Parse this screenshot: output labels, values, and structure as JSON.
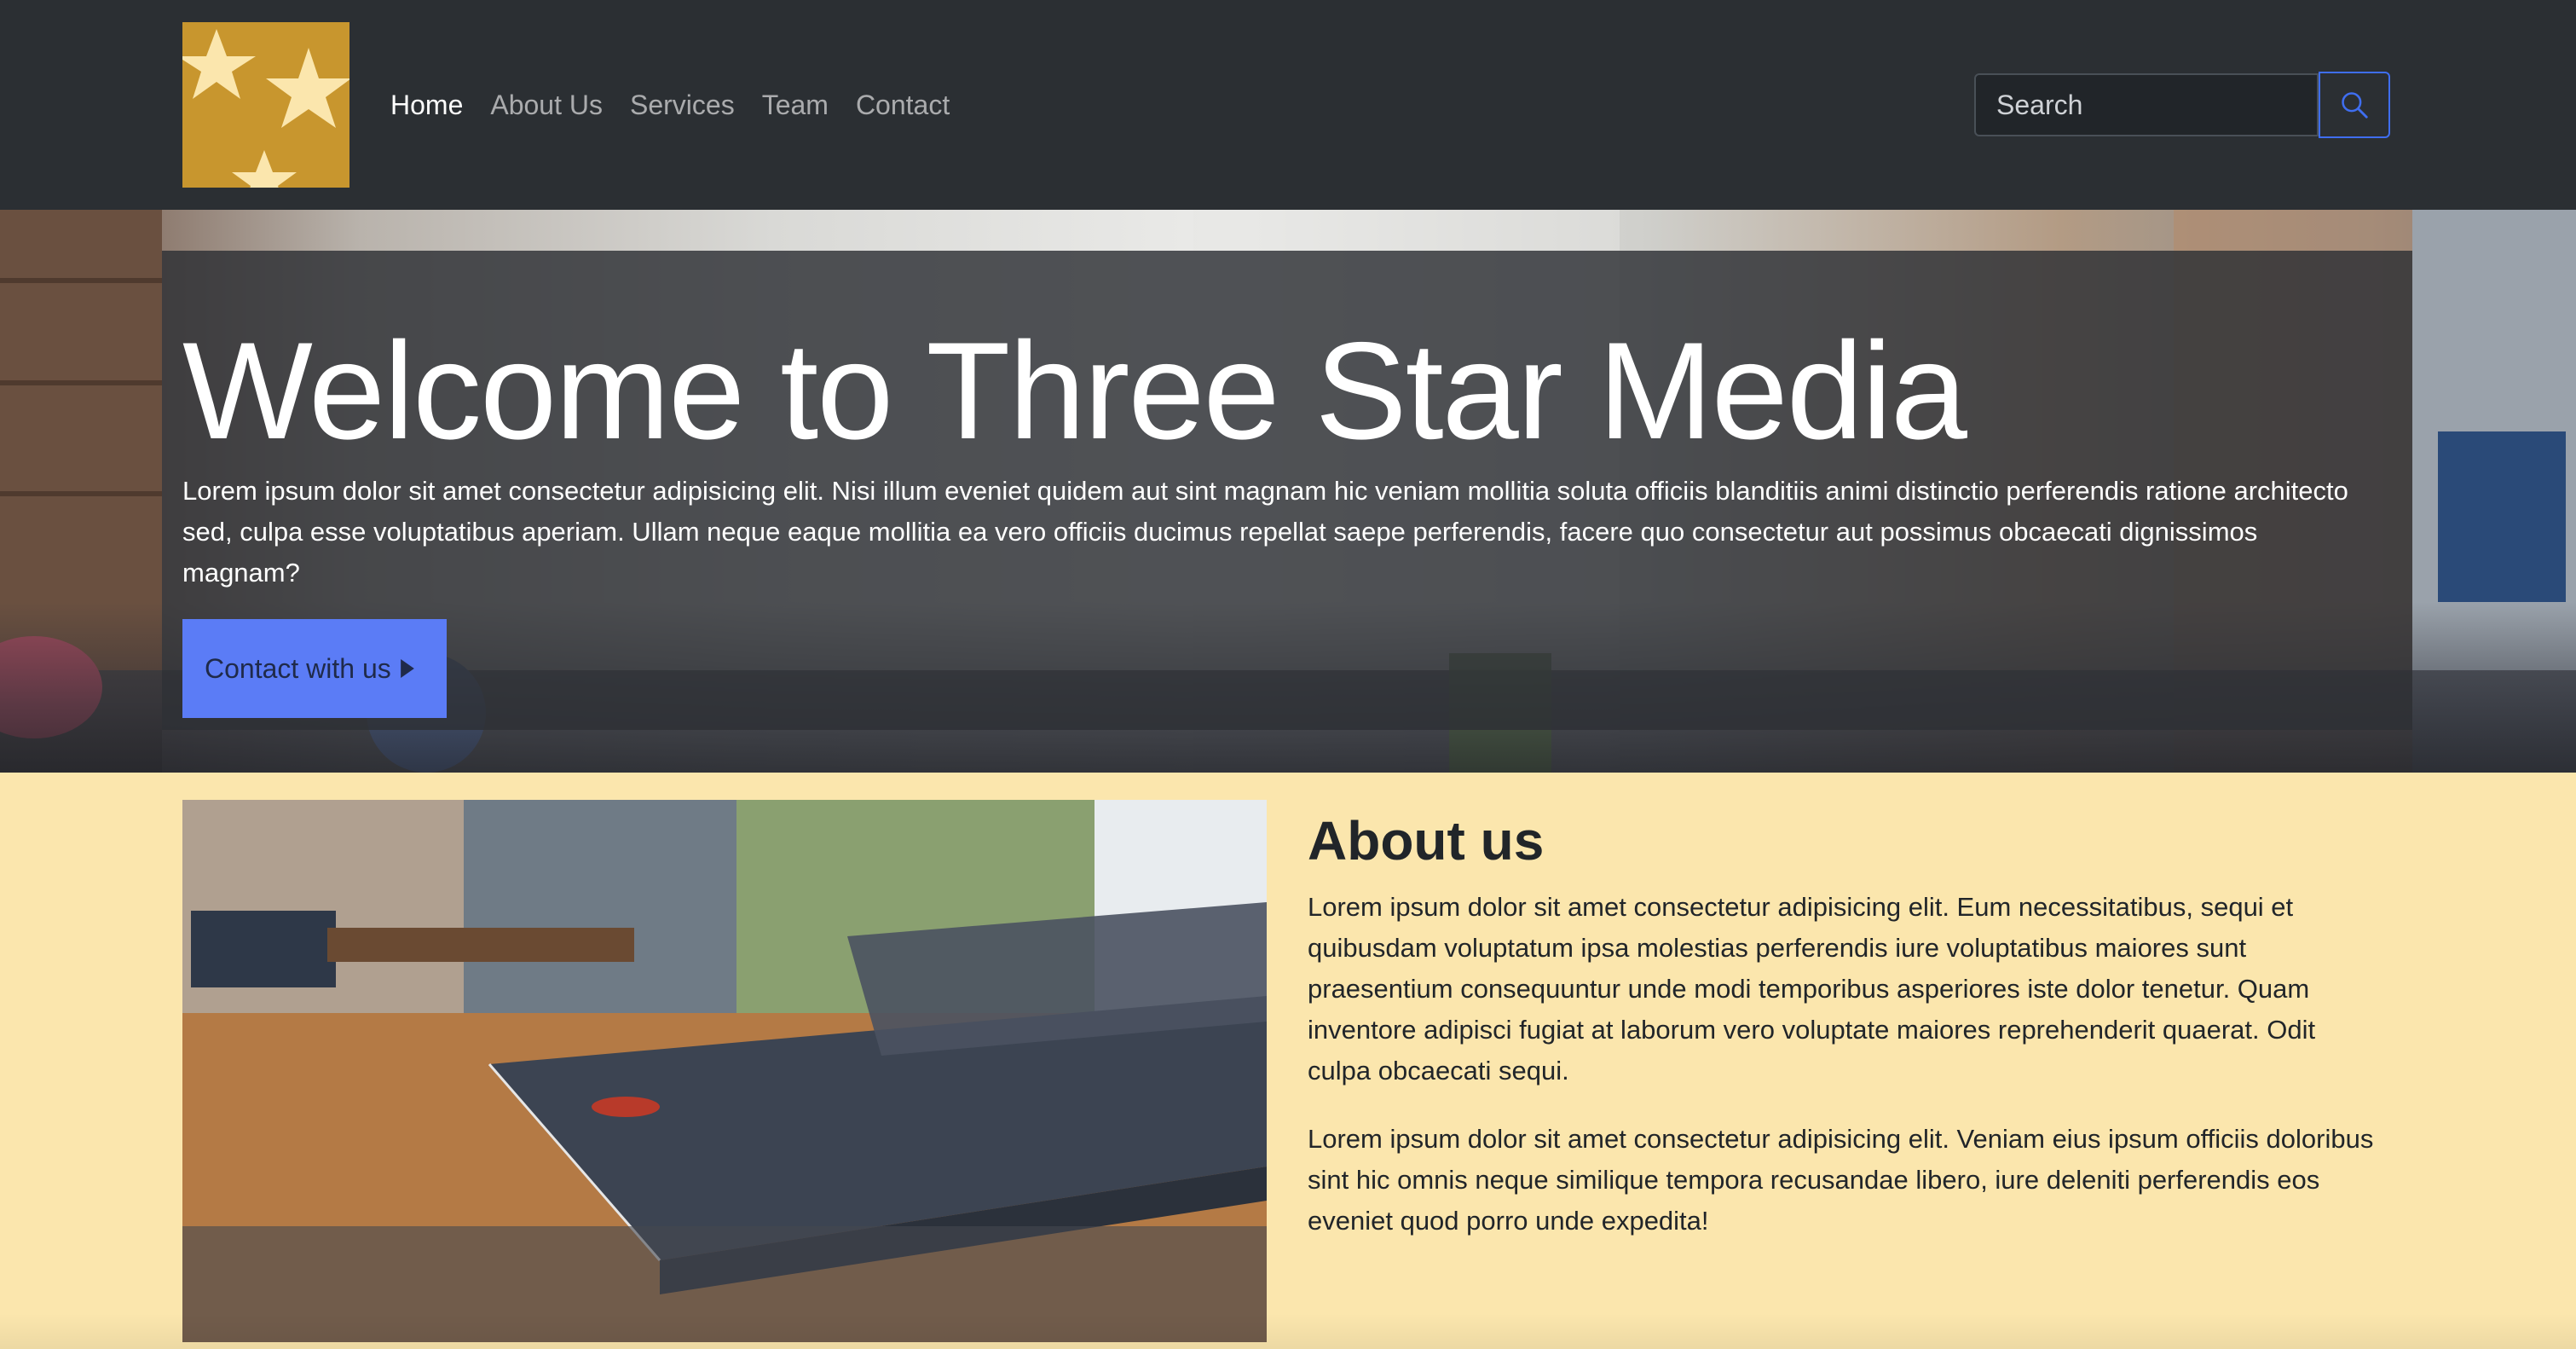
{
  "navbar": {
    "logo_name": "three-star-logo",
    "links": [
      {
        "label": "Home",
        "active": true
      },
      {
        "label": "About Us",
        "active": false
      },
      {
        "label": "Services",
        "active": false
      },
      {
        "label": "Team",
        "active": false
      },
      {
        "label": "Contact",
        "active": false
      }
    ],
    "search": {
      "placeholder": "Search",
      "value": "",
      "button_icon": "search-icon"
    }
  },
  "hero": {
    "title": "Welcome to Three Star Media",
    "text": "Lorem ipsum dolor sit amet consectetur adipisicing elit. Nisi illum eveniet quidem aut sint magnam hic veniam mollitia soluta officiis blanditiis animi distinctio perferendis ratione architecto sed, culpa esse voluptatibus aperiam. Ullam neque eaque mollitia ea vero officiis ducimus repellat saepe perferendis, facere quo consectetur aut possimus obcaecati dignissimos magnam?",
    "button_label": "Contact with us",
    "button_icon": "caret-right-icon"
  },
  "about": {
    "title": "About us",
    "paragraph_1": "Lorem ipsum dolor sit amet consectetur adipisicing elit. Eum necessitatibus, sequi et quibusdam voluptatum ipsa molestias perferendis iure voluptatibus maiores sunt praesentium consequuntur unde modi temporibus asperiores iste dolor tenetur. Quam inventore adipisci fugiat at laborum vero voluptate maiores reprehenderit quaerat. Odit culpa obcaecati sequi.",
    "paragraph_2": "Lorem ipsum dolor sit amet consectetur adipisicing elit. Veniam eius ipsum officiis doloribus sint hic omnis neque similique tempora recusandae libero, iure deleniti perferendis eos eveniet quod porro unde expedita!"
  },
  "colors": {
    "navbar_bg": "#2b2f33",
    "logo_bg": "#c8962e",
    "primary": "#5b7cf6",
    "section_bg": "#fbe6ad"
  }
}
